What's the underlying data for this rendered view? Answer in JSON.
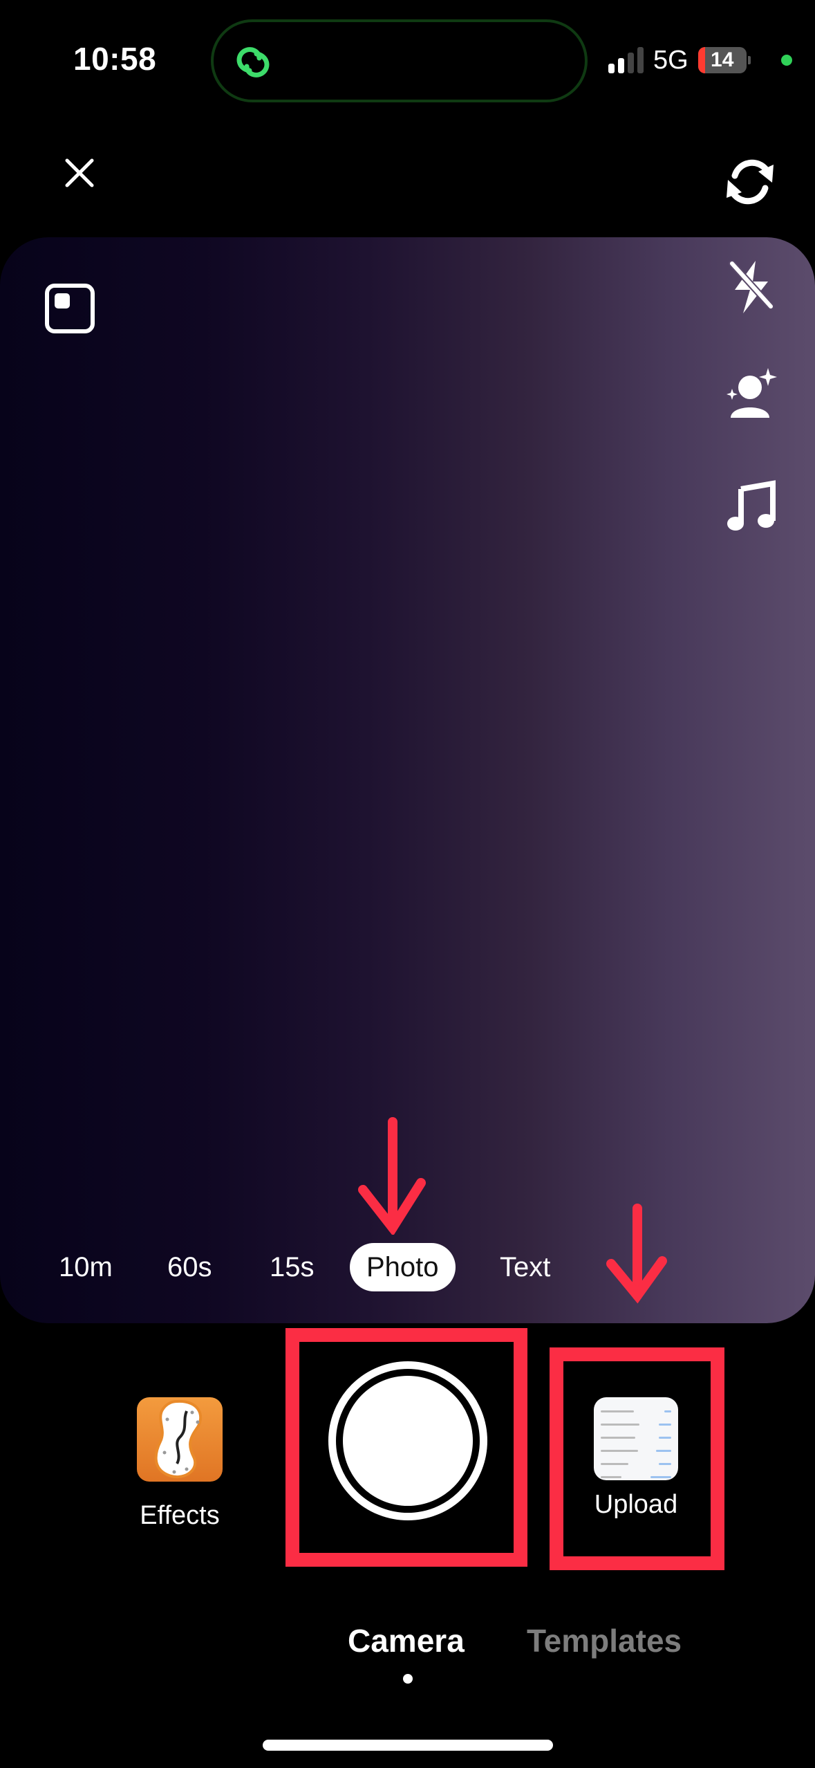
{
  "status_bar": {
    "time": "10:58",
    "network": "5G",
    "battery_level": "14",
    "battery_fraction": 0.14,
    "signal_bars_total": 4,
    "signal_bars_active": 2,
    "island_activity_icon": "link-icon",
    "colors": {
      "battery_low": "#ff3b30",
      "privacy_dot": "#30d158",
      "island_icon": "#3ddc6a"
    }
  },
  "top_controls": {
    "close_icon": "close-icon",
    "flip_icon": "flip-camera-icon"
  },
  "preview": {
    "aspect_ratio_icon": "aspect-ratio-icon",
    "side_tools": [
      {
        "name": "flash-off",
        "icon": "flash-off-icon"
      },
      {
        "name": "beauty",
        "icon": "person-sparkle-icon"
      },
      {
        "name": "sounds",
        "icon": "music-note-icon"
      }
    ],
    "modes": [
      {
        "label": "10m",
        "active": false
      },
      {
        "label": "60s",
        "active": false
      },
      {
        "label": "15s",
        "active": false
      },
      {
        "label": "Photo",
        "active": true
      },
      {
        "label": "Text",
        "active": false
      }
    ]
  },
  "bottom_controls": {
    "effects_label": "Effects",
    "upload_label": "Upload",
    "shutter_icon": "shutter-icon"
  },
  "tabs": [
    {
      "label": "Camera",
      "active": true
    },
    {
      "label": "Templates",
      "active": false
    }
  ],
  "annotations": {
    "color": "#fb2d44",
    "arrows": [
      "arrow-to-photo-mode",
      "arrow-to-upload"
    ],
    "boxes": [
      "box-shutter",
      "box-upload"
    ]
  }
}
